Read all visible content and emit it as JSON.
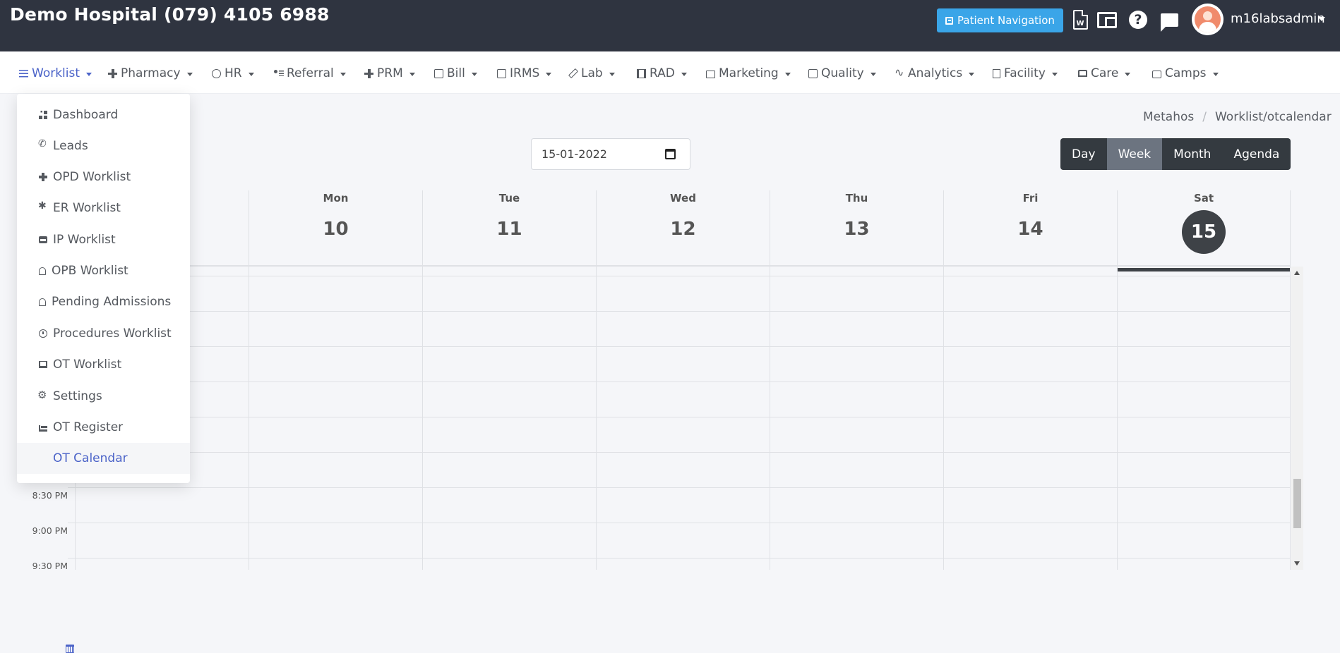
{
  "header": {
    "hospital_title": "Demo Hospital (079) 4105 6988",
    "patient_navigation_label": "Patient Navigation",
    "word_icon_letter": "W",
    "username": "m16labsadmin",
    "colors": {
      "topbar": "#2f3440",
      "accent": "#3aa5e8",
      "active_menu": "#4b63c8"
    }
  },
  "menu": {
    "items": [
      {
        "label": "Worklist",
        "icon": "list-icon"
      },
      {
        "label": "Pharmacy",
        "icon": "plus-icon"
      },
      {
        "label": "HR",
        "icon": "person-circle-icon"
      },
      {
        "label": "Referral",
        "icon": "person-lines-icon"
      },
      {
        "label": "PRM",
        "icon": "plus-icon"
      },
      {
        "label": "Bill",
        "icon": "cash-icon"
      },
      {
        "label": "IRMS",
        "icon": "card-icon"
      },
      {
        "label": "Lab",
        "icon": "pencil-icon"
      },
      {
        "label": "RAD",
        "icon": "film-icon"
      },
      {
        "label": "Marketing",
        "icon": "bag-icon"
      },
      {
        "label": "Quality",
        "icon": "card-icon"
      },
      {
        "label": "Analytics",
        "icon": "pulse-icon"
      },
      {
        "label": "Facility",
        "icon": "building-icon"
      },
      {
        "label": "Care",
        "icon": "bed-icon"
      },
      {
        "label": "Camps",
        "icon": "briefcase-icon"
      }
    ]
  },
  "worklist_dropdown": {
    "items": [
      {
        "label": "Dashboard",
        "icon": "dashboard-icon"
      },
      {
        "label": "Leads",
        "icon": "phone-icon"
      },
      {
        "label": "OPD Worklist",
        "icon": "plus-icon"
      },
      {
        "label": "ER Worklist",
        "icon": "asterisk-icon"
      },
      {
        "label": "IP Worklist",
        "icon": "car-icon"
      },
      {
        "label": "OPB Worklist",
        "icon": "bell-icon"
      },
      {
        "label": "Pending Admissions",
        "icon": "bell-icon"
      },
      {
        "label": "Procedures Worklist",
        "icon": "clock-icon"
      },
      {
        "label": "OT Worklist",
        "icon": "couch-icon"
      },
      {
        "label": "Settings",
        "icon": "gear-icon"
      },
      {
        "label": "OT Register",
        "icon": "bed-icon"
      },
      {
        "label": "OT Calendar",
        "icon": "calendar-icon"
      }
    ],
    "active": "OT Calendar"
  },
  "breadcrumb": {
    "root": "Metahos",
    "separator": "/",
    "current": "Worklist/otcalendar"
  },
  "date_picker": {
    "value": "15-01-2022"
  },
  "view_toggle": {
    "buttons": [
      "Day",
      "Week",
      "Month",
      "Agenda"
    ],
    "active": "Week"
  },
  "calendar": {
    "days": [
      {
        "name": "Mon",
        "date": "10"
      },
      {
        "name": "Tue",
        "date": "11"
      },
      {
        "name": "Wed",
        "date": "12"
      },
      {
        "name": "Thu",
        "date": "13"
      },
      {
        "name": "Fri",
        "date": "14"
      },
      {
        "name": "Sat",
        "date": "15"
      }
    ],
    "today": "15",
    "time_labels": [
      "8:30 PM",
      "9:00 PM",
      "9:30 PM"
    ]
  }
}
